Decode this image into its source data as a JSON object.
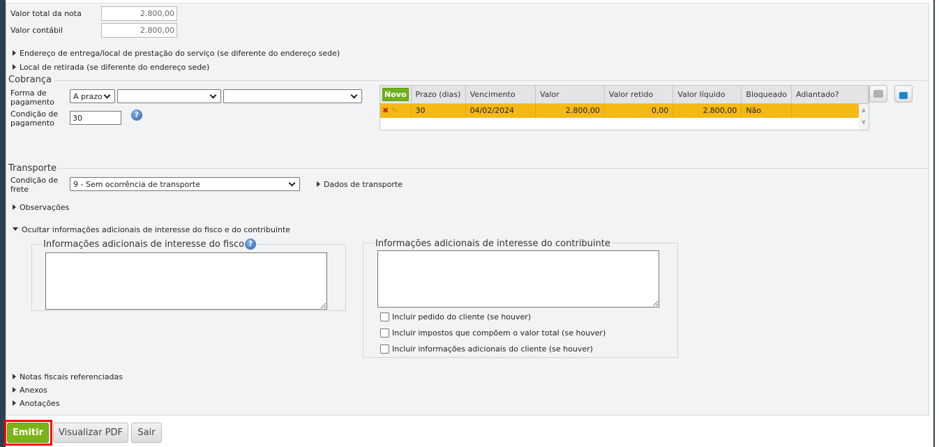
{
  "totals": {
    "valor_total_label": "Valor total da nota",
    "valor_total": "2.800,00",
    "valor_contabil_label": "Valor contábil",
    "valor_contabil": "2.800,00"
  },
  "toggles": {
    "endereco": "Endereço de entrega/local de prestação do serviço (se diferente do endereço sede)",
    "retirada": "Local de retirada (se diferente do endereço sede)",
    "dados_transporte": "Dados de transporte",
    "observacoes": "Observações",
    "ocultar": "Ocultar informações adicionais de interesse do fisco e do contribuinte",
    "notas": "Notas fiscais referenciadas",
    "anexos": "Anexos",
    "anotacoes": "Anotações"
  },
  "cobranca": {
    "title": "Cobrança",
    "forma_label_1": "Forma de",
    "forma_label_2": "pagamento",
    "forma_value": "A prazo",
    "forma_select2": "",
    "forma_select3": "",
    "condicao_label_1": "Condição de",
    "condicao_label_2": "pagamento",
    "condicao_value": "30",
    "help": "?"
  },
  "grid": {
    "novo": "Novo",
    "columns": [
      "Prazo (dias)",
      "Vencimento",
      "Valor",
      "Valor retido",
      "Valor líquido",
      "Bloqueado",
      "Adiantado?"
    ],
    "rows": [
      {
        "prazo": "30",
        "vencimento": "04/02/2024",
        "valor": "2.800,00",
        "retido": "0,00",
        "liquido": "2.800,00",
        "bloqueado": "Não",
        "adiantado": ""
      }
    ]
  },
  "transporte": {
    "title": "Transporte",
    "frete_label_1": "Condição de",
    "frete_label_2": "frete",
    "frete_value": "9 - Sem ocorrência de transporte"
  },
  "info": {
    "fisco_title": "Informações adicionais de interesse do fisco",
    "contrib_title": "Informações adicionais de interesse do contribuinte",
    "fisco_value": "",
    "contrib_value": "",
    "checks": [
      "Incluir pedido do cliente (se houver)",
      "Incluir impostos que compõem o valor total (se houver)",
      "Incluir informações adicionais do cliente (se houver)"
    ]
  },
  "buttons": {
    "emitir": "Emitir",
    "pdf": "Visualizar PDF",
    "sair": "Sair"
  },
  "colors": {
    "accent": "#6fb11f",
    "row": "#f5b914",
    "highlight": "#ff0000"
  }
}
